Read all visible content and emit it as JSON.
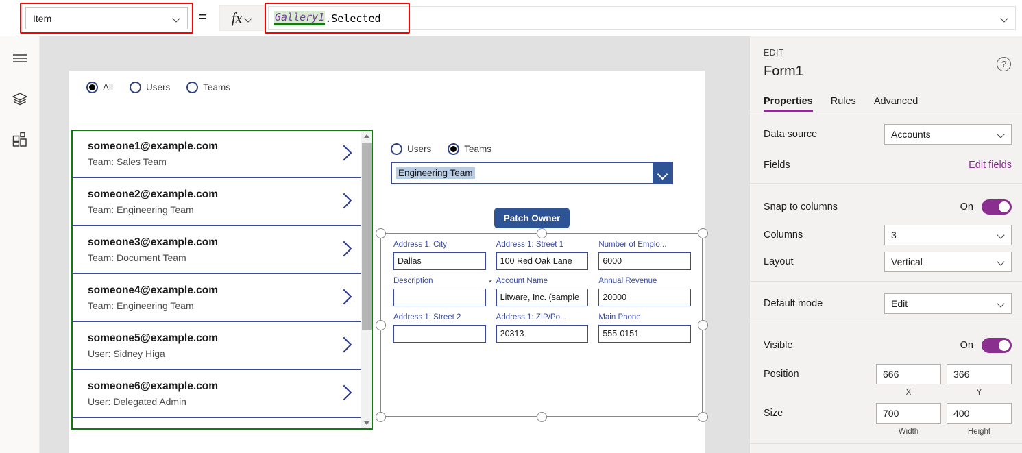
{
  "formula_bar": {
    "property_label": "Item",
    "equals": "=",
    "fx_label": "fx",
    "formula_identifier": "Gallery1",
    "formula_rest": ".Selected"
  },
  "left_rail": {
    "items": [
      {
        "name": "hamburger-menu-icon",
        "label": "Menu"
      },
      {
        "name": "tree-view-icon",
        "label": "Tree view"
      },
      {
        "name": "insert-icon",
        "label": "Insert"
      }
    ]
  },
  "canvas": {
    "radio_group_top": {
      "options": [
        {
          "label": "All",
          "selected": true
        },
        {
          "label": "Users",
          "selected": false
        },
        {
          "label": "Teams",
          "selected": false
        }
      ]
    },
    "gallery": {
      "items": [
        {
          "title": "someone1@example.com",
          "subtitle": "Team: Sales Team"
        },
        {
          "title": "someone2@example.com",
          "subtitle": "Team: Engineering Team"
        },
        {
          "title": "someone3@example.com",
          "subtitle": "Team: Document Team"
        },
        {
          "title": "someone4@example.com",
          "subtitle": "Team: Engineering Team"
        },
        {
          "title": "someone5@example.com",
          "subtitle": "User: Sidney Higa"
        },
        {
          "title": "someone6@example.com",
          "subtitle": "User: Delegated Admin"
        }
      ]
    },
    "radio_group_right": {
      "options": [
        {
          "label": "Users",
          "selected": false
        },
        {
          "label": "Teams",
          "selected": true
        }
      ]
    },
    "combobox": {
      "value": "Engineering Team"
    },
    "patch_button": {
      "label": "Patch Owner"
    },
    "form_fields": [
      {
        "label": "Address 1: City",
        "value": "Dallas",
        "required": false
      },
      {
        "label": "Address 1: Street 1",
        "value": "100 Red Oak Lane",
        "required": false
      },
      {
        "label": "Number of Emplo...",
        "value": "6000",
        "required": false
      },
      {
        "label": "Description",
        "value": "",
        "required": false
      },
      {
        "label": "Account Name",
        "value": "Litware, Inc. (sample",
        "required": true
      },
      {
        "label": "Annual Revenue",
        "value": "20000",
        "required": false
      },
      {
        "label": "Address 1: Street 2",
        "value": "",
        "required": false
      },
      {
        "label": "Address 1: ZIP/Po...",
        "value": "20313",
        "required": false
      },
      {
        "label": "Main Phone",
        "value": "555-0151",
        "required": false
      }
    ]
  },
  "right_panel": {
    "eyebrow": "EDIT",
    "title": "Form1",
    "help_icon_label": "?",
    "tabs": [
      {
        "label": "Properties",
        "active": true
      },
      {
        "label": "Rules",
        "active": false
      },
      {
        "label": "Advanced",
        "active": false
      }
    ],
    "data_source": {
      "label": "Data source",
      "value": "Accounts"
    },
    "fields": {
      "label": "Fields",
      "action": "Edit fields"
    },
    "snap_to_columns": {
      "label": "Snap to columns",
      "state": "On"
    },
    "columns": {
      "label": "Columns",
      "value": "3"
    },
    "layout": {
      "label": "Layout",
      "value": "Vertical"
    },
    "default_mode": {
      "label": "Default mode",
      "value": "Edit"
    },
    "visible": {
      "label": "Visible",
      "state": "On"
    },
    "position": {
      "label": "Position",
      "x": "666",
      "y": "366",
      "x_caption": "X",
      "y_caption": "Y"
    },
    "size": {
      "label": "Size",
      "width": "700",
      "height": "400",
      "width_caption": "Width",
      "height_caption": "Height"
    }
  },
  "colors": {
    "accent_purple": "#8a2f8f",
    "annotation_red": "#ff0000",
    "selection_green": "#107c10",
    "form_blue": "#3b4b9e",
    "button_blue": "#2f5496"
  }
}
